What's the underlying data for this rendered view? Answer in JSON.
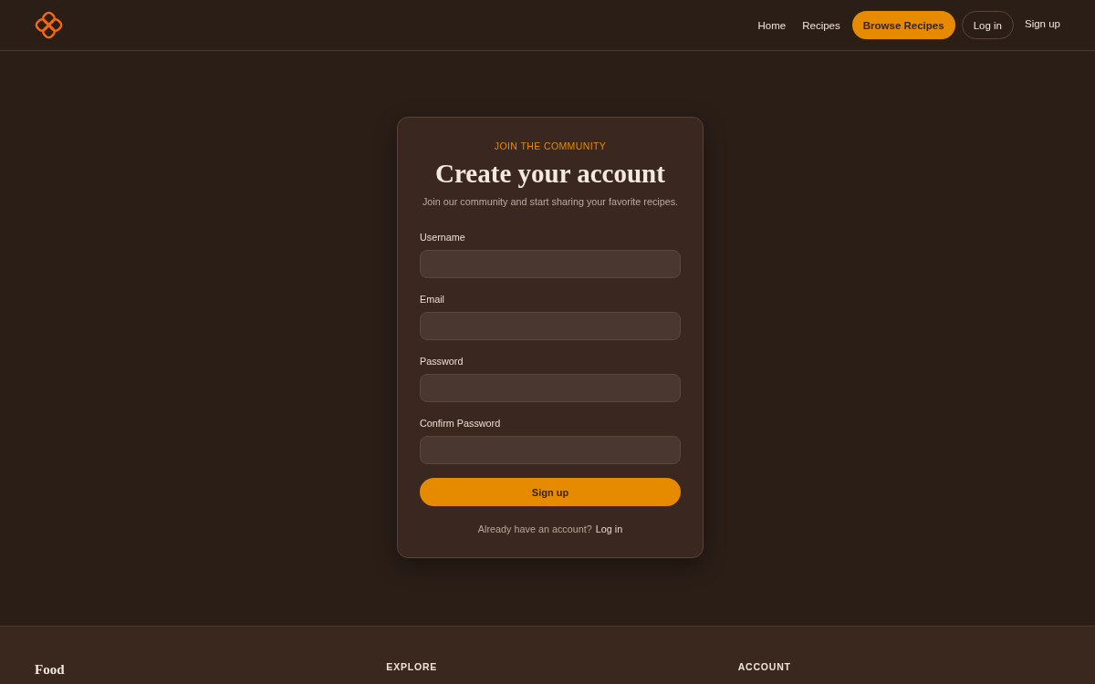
{
  "header": {
    "nav": [
      {
        "label": "Home",
        "kind": "link"
      },
      {
        "label": "Recipes",
        "kind": "link"
      },
      {
        "label": "Browse Recipes",
        "kind": "primary"
      },
      {
        "label": "Log in",
        "kind": "outline"
      },
      {
        "label": "Sign up",
        "kind": "link"
      }
    ]
  },
  "signup_card": {
    "eyebrow": "JOIN THE COMMUNITY",
    "title": "Create your account",
    "subtitle": "Join our community and start sharing your favorite recipes.",
    "fields": [
      {
        "label": "Username"
      },
      {
        "label": "Email"
      },
      {
        "label": "Password"
      },
      {
        "label": "Confirm Password"
      }
    ],
    "submit": "Sign up",
    "footer_text": "Already have an account?",
    "footer_link": "Log in"
  },
  "footer": {
    "brand": "Food",
    "columns": [
      {
        "heading": "EXPLORE"
      },
      {
        "heading": "ACCOUNT"
      }
    ]
  }
}
